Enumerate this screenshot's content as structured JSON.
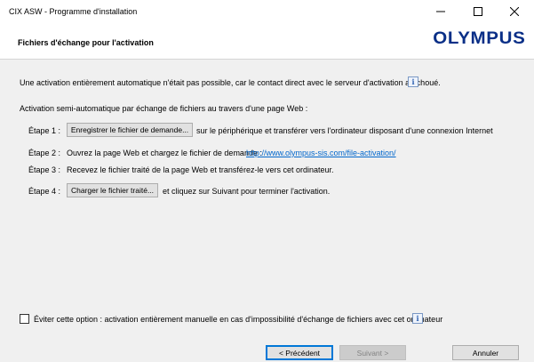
{
  "window": {
    "title": "CIX ASW - Programme d'installation",
    "controls": [
      "minimize-icon",
      "maximize-icon",
      "close-icon"
    ]
  },
  "header": {
    "title": "Fichiers d'échange pour l'activation",
    "logo": "OLYMPUS"
  },
  "content": {
    "intro": "Une activation entièrement automatique n'était pas possible, car le contact direct avec le serveur d'activation a échoué.",
    "semi_auto": "Activation semi-automatique par échange de fichiers au travers d'une page Web :",
    "steps": [
      {
        "label": "Étape 1 :",
        "button": "Enregistrer le fichier de demande...",
        "text": "sur le périphérique et transférer vers l'ordinateur disposant d'une connexion Internet"
      },
      {
        "label": "Étape 2 :",
        "text": "Ouvrez la page Web et chargez le fichier de demande :",
        "link": "http://www.olympus-sis.com/file-activation/"
      },
      {
        "label": "Étape 3 :",
        "text": "Recevez le fichier traité de la page Web et transférez-le vers cet ordinateur."
      },
      {
        "label": "Étape 4 :",
        "button": "Charger le fichier traité...",
        "text": "et cliquez sur Suivant pour terminer l'activation."
      }
    ]
  },
  "footer": {
    "checkbox_label": "Éviter cette option : activation entièrement manuelle en cas d'impossibilité d'échange de fichiers avec cet ordinateur",
    "checkbox_checked": false,
    "buttons": {
      "previous": "< Précédent",
      "next": "Suivant >",
      "cancel": "Annuler"
    }
  },
  "colors": {
    "logo": "#0a2f87",
    "link": "#0066cc",
    "panel": "#f0f0f0",
    "default_button_border": "#0078d7"
  }
}
